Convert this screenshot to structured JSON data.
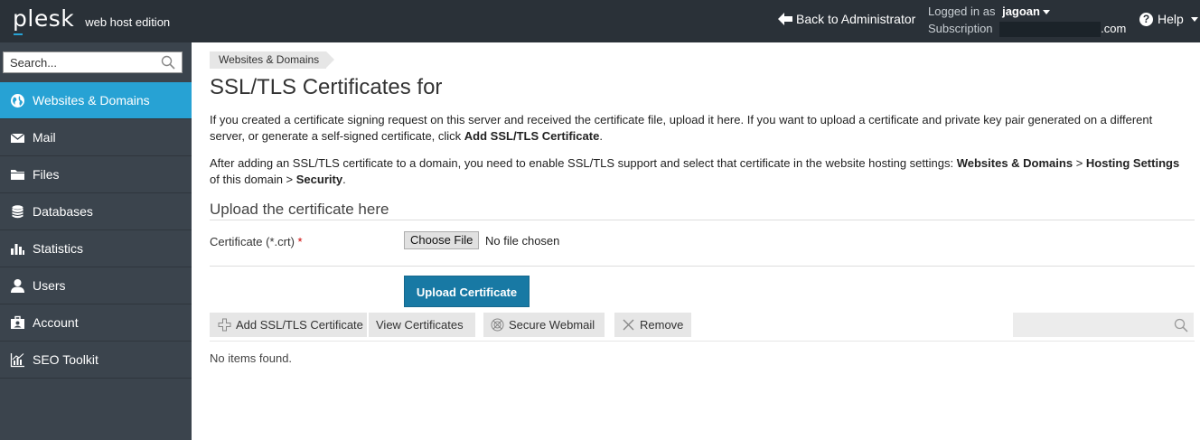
{
  "header": {
    "logo_text": "plesk",
    "edition": "web host edition",
    "back_label": "Back to Administrator",
    "logged_in_label": "Logged in as",
    "username": "jagoan",
    "subscription_label": "Subscription",
    "subscription_suffix": ".com",
    "help_label": "Help"
  },
  "sidebar": {
    "search_placeholder": "Search...",
    "items": [
      {
        "label": "Websites & Domains",
        "icon": "globe-icon",
        "active": true
      },
      {
        "label": "Mail",
        "icon": "envelope-icon"
      },
      {
        "label": "Files",
        "icon": "folder-icon"
      },
      {
        "label": "Databases",
        "icon": "database-icon"
      },
      {
        "label": "Statistics",
        "icon": "bar-chart-icon"
      },
      {
        "label": "Users",
        "icon": "user-icon"
      },
      {
        "label": "Account",
        "icon": "account-icon"
      },
      {
        "label": "SEO Toolkit",
        "icon": "seo-chart-icon"
      }
    ]
  },
  "main": {
    "breadcrumb": "Websites & Domains",
    "title": "SSL/TLS Certificates for",
    "desc1_text": "If you created a certificate signing request on this server and received the certificate file, upload it here. If you want to upload a certificate and private key pair generated on a different server, or generate a self-signed certificate, click ",
    "desc1_bold": "Add SSL/TLS Certificate",
    "desc1_end": ".",
    "desc2_text": "After adding an SSL/TLS certificate to a domain, you need to enable SSL/TLS support and select that certificate in the website hosting settings: ",
    "desc2_bold1": "Websites & Domains",
    "desc2_sep1": " > ",
    "desc2_bold2": "Hosting Settings",
    "desc2_mid": " of this domain > ",
    "desc2_bold3": "Security",
    "desc2_end": ".",
    "section_title": "Upload the certificate here",
    "cert_label": "Certificate (*.crt)",
    "required_mark": "*",
    "choose_file_label": "Choose File",
    "no_file_label": "No file chosen",
    "upload_button": "Upload Certificate",
    "toolbar": {
      "add_label": "Add SSL/TLS Certificate",
      "view_label": "View Certificates",
      "webmail_label": "Secure Webmail",
      "remove_label": "Remove"
    },
    "empty_message": "No items found."
  }
}
